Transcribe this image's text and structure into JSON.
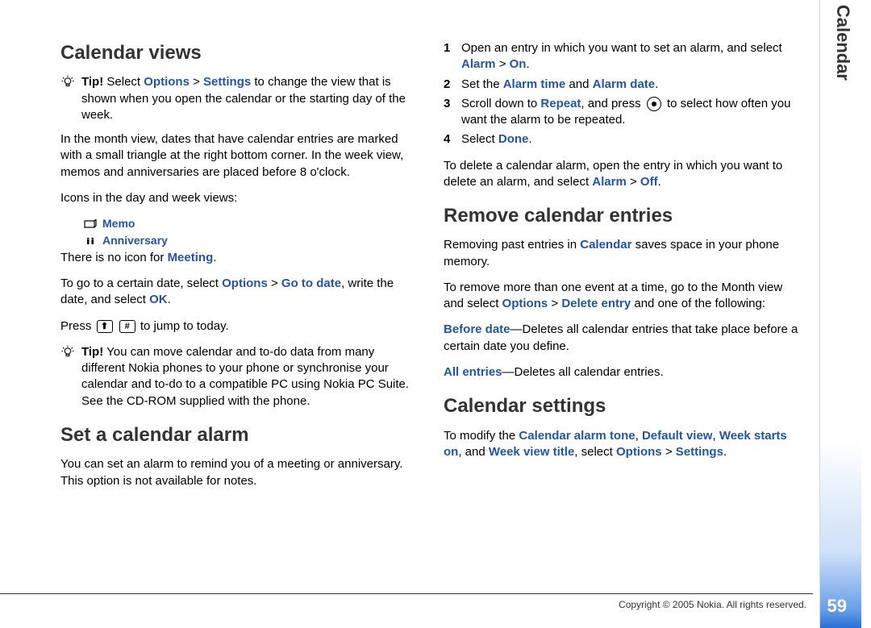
{
  "sidebar": {
    "chapter": "Calendar",
    "page": "59"
  },
  "footer": {
    "copyright": "Copyright © 2005 Nokia. All rights reserved."
  },
  "col1": {
    "h1": "Calendar views",
    "tip1": {
      "label": "Tip!",
      "a": " Select ",
      "b": "Options",
      "sep": " > ",
      "c": "Settings",
      "d": " to change the view that is shown when you open the calendar or the starting day of the week."
    },
    "p1": "In the month view, dates that have calendar entries are marked with a small triangle at the right bottom corner. In the week view, memos and anniversaries are placed before 8 o'clock.",
    "p2": "Icons in the day and week views:",
    "icon1": "Memo",
    "icon2": "Anniversary",
    "noicon_a": "There is no icon for ",
    "noicon_b": "Meeting",
    "noicon_c": ".",
    "p3": {
      "a": "To go to a certain date, select ",
      "b": "Options",
      "sep": " > ",
      "c": "Go to date",
      "d": ", write the date, and select ",
      "e": "OK",
      "f": "."
    },
    "p4": {
      "a": "Press ",
      "k1": "⬆",
      "k2": "#",
      "b": " to jump to today."
    },
    "tip2": {
      "label": "Tip!",
      "body": " You can move calendar and to-do data from many different Nokia phones to your phone or synchronise your calendar and to-do to a compatible PC using Nokia PC Suite. See the CD-ROM supplied with the phone."
    },
    "h2": "Set a calendar alarm",
    "p5": "You can set an alarm to remind you of a meeting or anniversary. This option is not available for notes."
  },
  "col2": {
    "ol": [
      {
        "n": "1",
        "a": "Open an entry in which you want to set an alarm, and select ",
        "b": "Alarm",
        "sep": " > ",
        "c": "On",
        "d": "."
      },
      {
        "n": "2",
        "a": "Set the ",
        "b": "Alarm time",
        "mid": " and ",
        "c": "Alarm date",
        "d": "."
      },
      {
        "n": "3",
        "a": "Scroll down to ",
        "b": "Repeat",
        "mid": ", and press ",
        "joy": true,
        "c": " to select how often you want the alarm to be repeated."
      },
      {
        "n": "4",
        "a": "Select ",
        "b": "Done",
        "d": "."
      }
    ],
    "p1": {
      "a": "To delete a calendar alarm, open the entry in which you want to delete an alarm, and select ",
      "b": "Alarm",
      "sep": " > ",
      "c": "Off",
      "d": "."
    },
    "h2": "Remove calendar entries",
    "p2": {
      "a": "Removing past entries in ",
      "b": "Calendar",
      "c": " saves space in your phone memory."
    },
    "p3": {
      "a": "To remove more than one event at a time, go to the Month view and select ",
      "b": "Options",
      "sep": " > ",
      "c": "Delete entry",
      "d": " and one of the following:"
    },
    "p4": {
      "a": "Before date",
      "b": "—Deletes all calendar entries that take place before a certain date you define."
    },
    "p5": {
      "a": "All entries",
      "b": "—Deletes all calendar entries."
    },
    "h3": "Calendar settings",
    "p6": {
      "a": "To modify the ",
      "b": "Calendar alarm tone",
      "c": ", ",
      "d": "Default view",
      "e": ", ",
      "f": "Week starts on",
      "g": ", and ",
      "h": "Week view title",
      "i": ", select ",
      "j": "Options",
      "sep": " > ",
      "k": "Settings",
      "l": "."
    }
  }
}
